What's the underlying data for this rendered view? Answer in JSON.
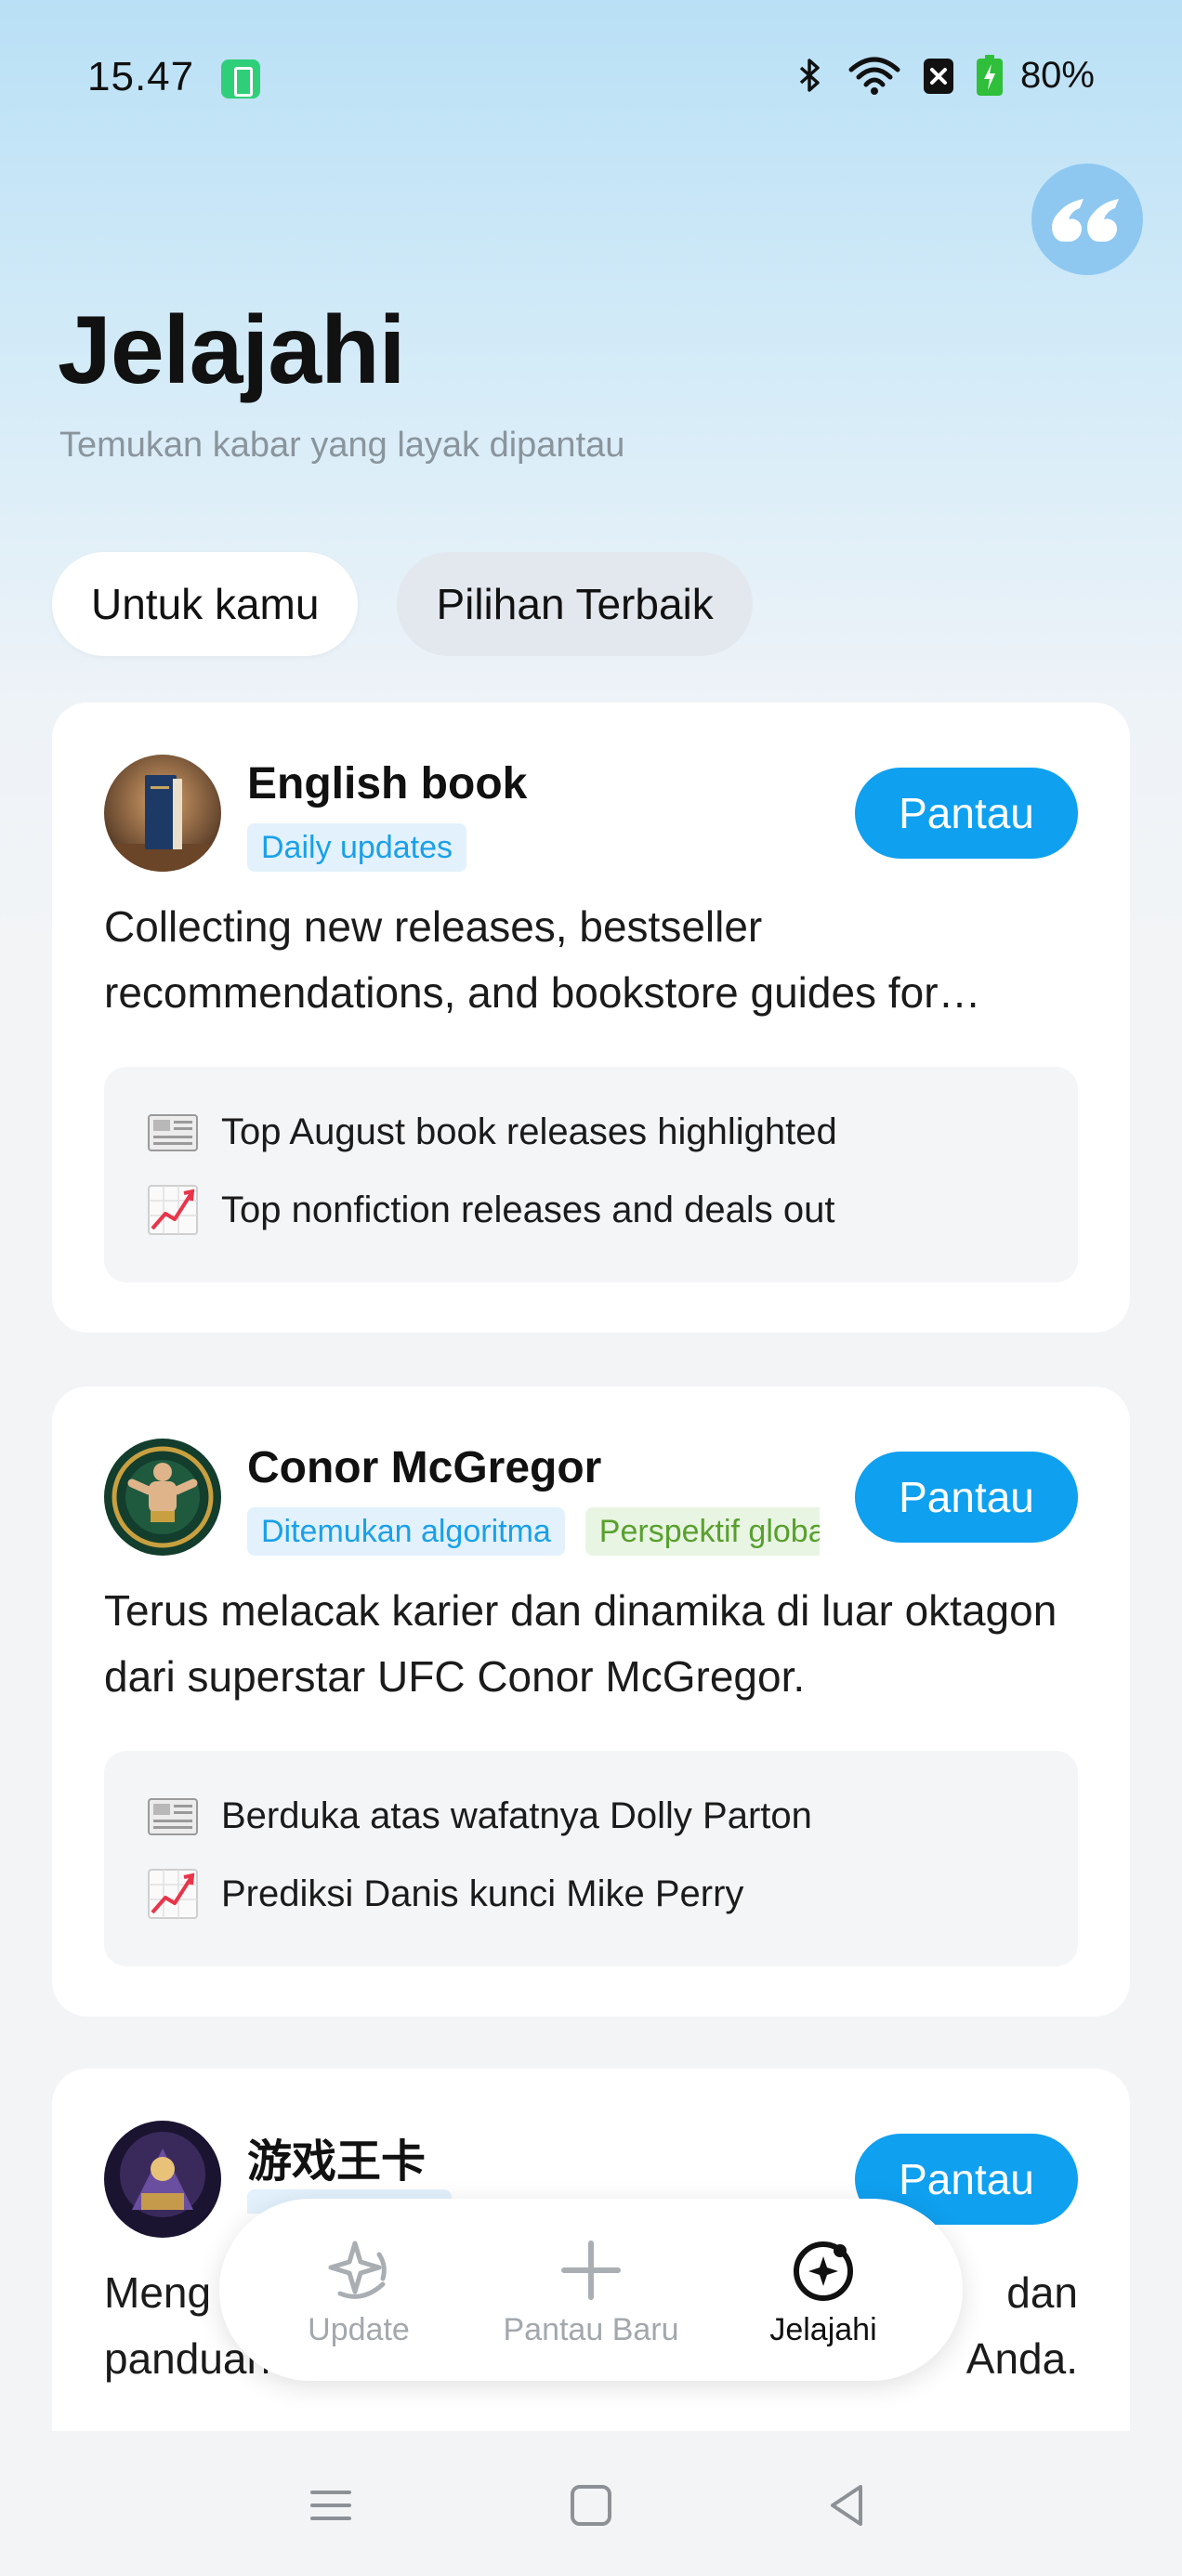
{
  "status_bar": {
    "time": "15.47",
    "battery": "80%"
  },
  "header": {
    "title": "Jelajahi",
    "subtitle": "Temukan kabar yang layak dipantau"
  },
  "tabs": [
    {
      "label": "Untuk kamu",
      "active": true
    },
    {
      "label": "Pilihan Terbaik",
      "active": false
    }
  ],
  "cards": [
    {
      "name": "English book",
      "tags": [
        "Daily updates"
      ],
      "follow_label": "Pantau",
      "description": "Collecting new releases, bestseller recommendations, and bookstore guides for…",
      "news": [
        {
          "icon": "newspaper-icon",
          "text": "Top August book releases highlighted"
        },
        {
          "icon": "chart-increasing-icon",
          "text": "Top nonfiction releases and deals out"
        }
      ]
    },
    {
      "name": "Conor McGregor",
      "tags": [
        "Ditemukan algoritma",
        "Perspektif global"
      ],
      "follow_label": "Pantau",
      "description": "Terus melacak karier dan dinamika di luar oktagon dari superstar UFC Conor McGregor.",
      "news": [
        {
          "icon": "newspaper-icon",
          "text": "Berduka atas wafatnya Dolly Parton"
        },
        {
          "icon": "chart-increasing-icon",
          "text": "Prediksi Danis kunci Mike Perry"
        }
      ]
    },
    {
      "name": "游戏王卡",
      "follow_label": "Pantau",
      "description_left_line1": "Meng",
      "description_left_line2": "panduan",
      "description_right_line1": "dan",
      "description_right_line2": "Anda."
    }
  ],
  "bottom_nav": [
    {
      "label": "Update",
      "icon": "sparkle-update-icon",
      "active": false
    },
    {
      "label": "Pantau Baru",
      "icon": "plus-icon",
      "active": false
    },
    {
      "label": "Jelajahi",
      "icon": "explore-icon",
      "active": true
    }
  ],
  "colors": {
    "accent": "#0fa0ef",
    "tag_blue": "#1aa0e8",
    "tag_green": "#58a02e"
  }
}
